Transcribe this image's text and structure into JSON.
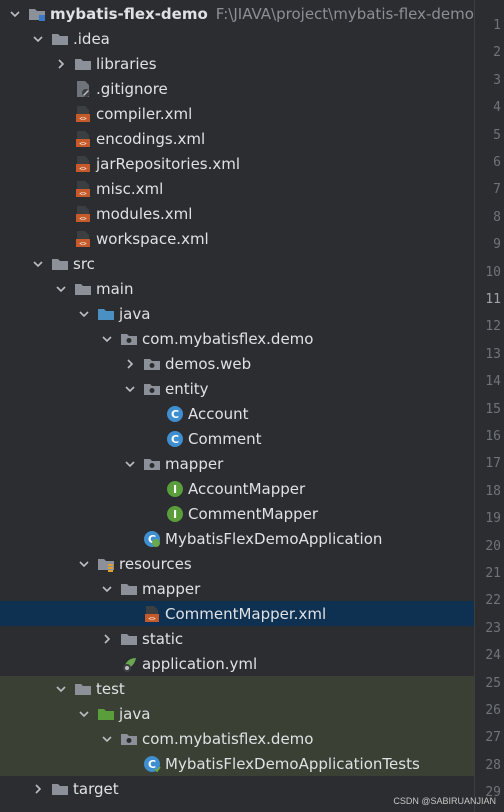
{
  "tree": {
    "rows": [
      {
        "label": "mybatis-flex-demo",
        "path": "F:\\JIAVA\\project\\mybatis-flex-demo"
      },
      {
        "label": ".idea"
      },
      {
        "label": "libraries"
      },
      {
        "label": ".gitignore"
      },
      {
        "label": "compiler.xml"
      },
      {
        "label": "encodings.xml"
      },
      {
        "label": "jarRepositories.xml"
      },
      {
        "label": "misc.xml"
      },
      {
        "label": "modules.xml"
      },
      {
        "label": "workspace.xml"
      },
      {
        "label": "src"
      },
      {
        "label": "main"
      },
      {
        "label": "java"
      },
      {
        "label": "com.mybatisflex.demo"
      },
      {
        "label": "demos.web"
      },
      {
        "label": "entity"
      },
      {
        "label": "Account"
      },
      {
        "label": "Comment"
      },
      {
        "label": "mapper"
      },
      {
        "label": "AccountMapper"
      },
      {
        "label": "CommentMapper"
      },
      {
        "label": "MybatisFlexDemoApplication"
      },
      {
        "label": "resources"
      },
      {
        "label": "mapper"
      },
      {
        "label": "CommentMapper.xml"
      },
      {
        "label": "static"
      },
      {
        "label": "application.yml"
      },
      {
        "label": "test"
      },
      {
        "label": "java"
      },
      {
        "label": "com.mybatisflex.demo"
      },
      {
        "label": "MybatisFlexDemoApplicationTests"
      },
      {
        "label": "target"
      }
    ]
  },
  "gutter": {
    "lines": [
      "1",
      "2",
      "3",
      "4",
      "5",
      "6",
      "7",
      "8",
      "9",
      "10",
      "11",
      "12",
      "13",
      "14",
      "15",
      "16",
      "17",
      "18",
      "19",
      "20",
      "21",
      "22",
      "23",
      "24",
      "25",
      "26",
      "27",
      "28",
      "29"
    ],
    "current_line": "11"
  },
  "watermark": "CSDN @SABIRUANJIAN",
  "colors": {
    "background": "#2b2d30",
    "selected": "#0e3051",
    "test_bg": "#3a4033",
    "folder": "#8c9199",
    "source_folder": "#4a90c2",
    "test_folder": "#5a9e3c",
    "xml_icon": "#c75a2a",
    "class_icon": "#3f8fd0",
    "interface_icon": "#5a9e3c"
  }
}
